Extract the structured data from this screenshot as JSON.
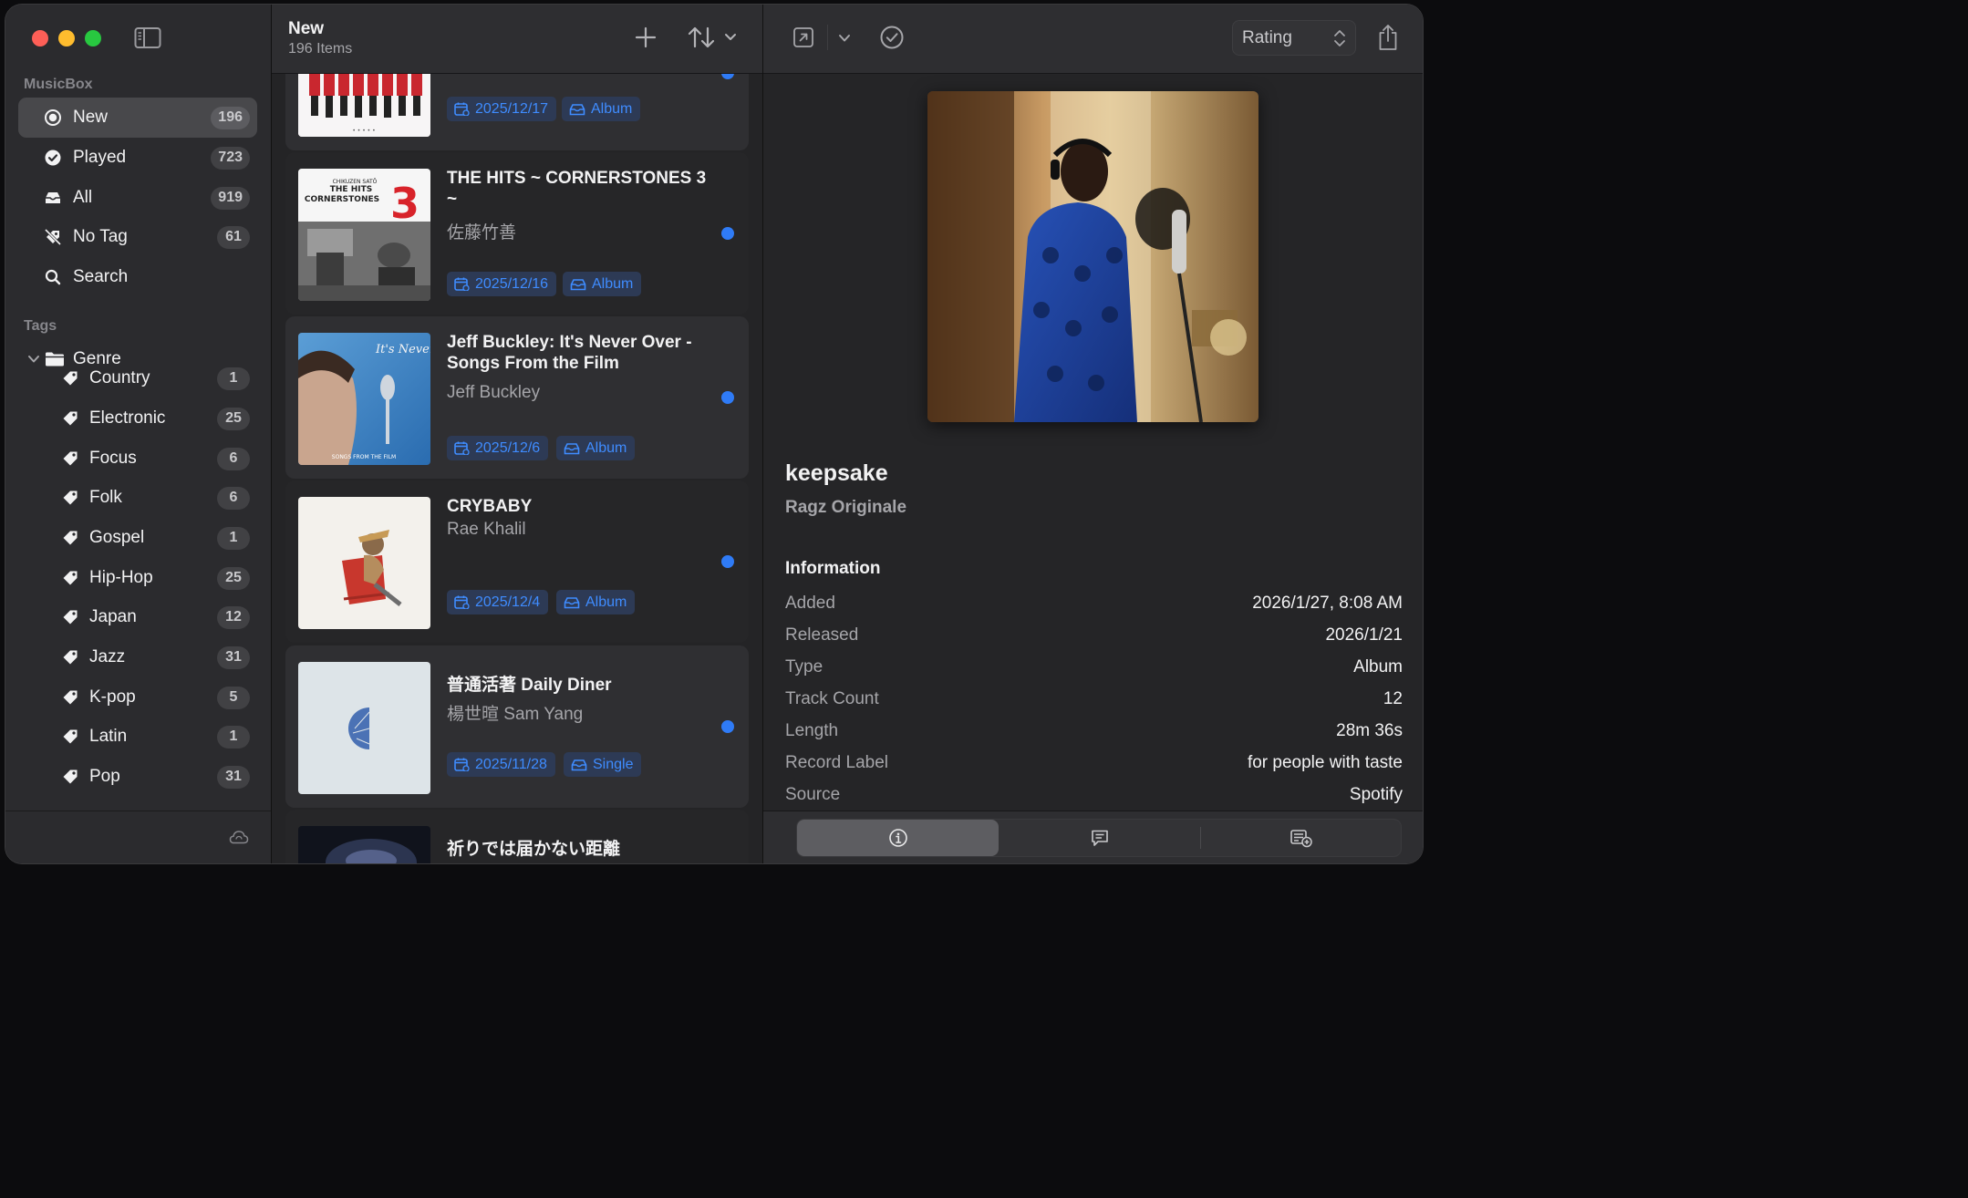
{
  "sidebar": {
    "section_musicbox": "MusicBox",
    "items": [
      {
        "label": "New",
        "count": "196",
        "icon": "inbox-circle-icon"
      },
      {
        "label": "Played",
        "count": "723",
        "icon": "checkmark-circle-icon"
      },
      {
        "label": "All",
        "count": "919",
        "icon": "tray-icon"
      },
      {
        "label": "No Tag",
        "count": "61",
        "icon": "tag-slash-icon"
      },
      {
        "label": "Search",
        "count": "",
        "icon": "magnifying-glass-icon"
      }
    ],
    "section_tags": "Tags",
    "genre_label": "Genre",
    "tags": [
      {
        "label": "Country",
        "count": "1"
      },
      {
        "label": "Electronic",
        "count": "25"
      },
      {
        "label": "Focus",
        "count": "6"
      },
      {
        "label": "Folk",
        "count": "6"
      },
      {
        "label": "Gospel",
        "count": "1"
      },
      {
        "label": "Hip-Hop",
        "count": "25"
      },
      {
        "label": "Japan",
        "count": "12"
      },
      {
        "label": "Jazz",
        "count": "31"
      },
      {
        "label": "K-pop",
        "count": "5"
      },
      {
        "label": "Latin",
        "count": "1"
      },
      {
        "label": "Pop",
        "count": "31"
      }
    ]
  },
  "list": {
    "title": "New",
    "subtitle": "196 Items",
    "cards": [
      {
        "title": "",
        "artist": "",
        "date": "2025/12/17",
        "type": "Album"
      },
      {
        "title": "THE HITS ~ CORNERSTONES 3 ~",
        "artist": "佐藤竹善",
        "date": "2025/12/16",
        "type": "Album",
        "cover_text_top": "CHIKUZEN SATŌ",
        "cover_text_mid": "THE HITS",
        "cover_text_main": "CORNERSTONES",
        "cover_number": "3"
      },
      {
        "title": "Jeff Buckley: It's Never Over - Songs From the Film",
        "artist": "Jeff Buckley",
        "date": "2025/12/6",
        "type": "Album",
        "cover_text": "It's Never Over",
        "cover_sub": "SONGS FROM THE FILM"
      },
      {
        "title": "CRYBABY",
        "artist": "Rae Khalil",
        "date": "2025/12/4",
        "type": "Album"
      },
      {
        "title": "普通活著 Daily Diner",
        "artist": "楊世暄 Sam Yang",
        "date": "2025/11/28",
        "type": "Single"
      },
      {
        "title": "祈りでは届かない距離",
        "artist": "",
        "date": "",
        "type": ""
      }
    ]
  },
  "detail": {
    "rating_label": "Rating",
    "title": "keepsake",
    "artist": "Ragz Originale",
    "section": "Information",
    "info": [
      {
        "k": "Added",
        "v": "2026/1/27, 8:08 AM"
      },
      {
        "k": "Released",
        "v": "2026/1/21"
      },
      {
        "k": "Type",
        "v": "Album"
      },
      {
        "k": "Track Count",
        "v": "12"
      },
      {
        "k": "Length",
        "v": "28m 36s"
      },
      {
        "k": "Record Label",
        "v": "for people with taste"
      },
      {
        "k": "Source",
        "v": "Spotify"
      }
    ]
  },
  "colors": {
    "accent": "#2f7bf6",
    "pill_text": "#3f8cff",
    "pill_bg": "#2d3a55"
  }
}
